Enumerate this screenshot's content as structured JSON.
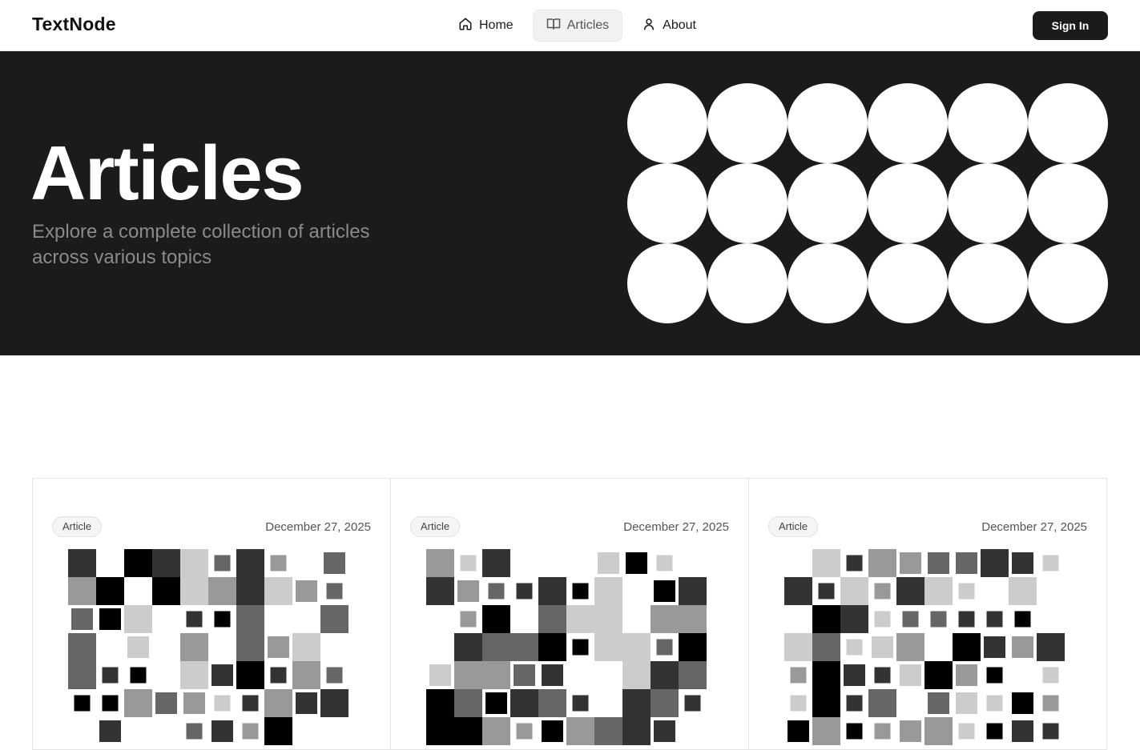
{
  "header": {
    "brand": "TextNode",
    "nav": [
      {
        "label": "Home",
        "icon": "home-icon"
      },
      {
        "label": "Articles",
        "icon": "book-open-icon",
        "active": true
      },
      {
        "label": "About",
        "icon": "user-icon"
      }
    ],
    "signin_label": "Sign In"
  },
  "hero": {
    "title": "Articles",
    "subtitle": "Explore a complete collection of articles across various topics"
  },
  "articles": [
    {
      "tag": "Article",
      "date": "December 27, 2025"
    },
    {
      "tag": "Article",
      "date": "December 27, 2025"
    },
    {
      "tag": "Article",
      "date": "December 27, 2025"
    }
  ],
  "colors": {
    "dark": "#1b1b1b",
    "mosaic_palette": [
      "#000000",
      "#333333",
      "#666666",
      "#999999",
      "#cccccc"
    ]
  }
}
